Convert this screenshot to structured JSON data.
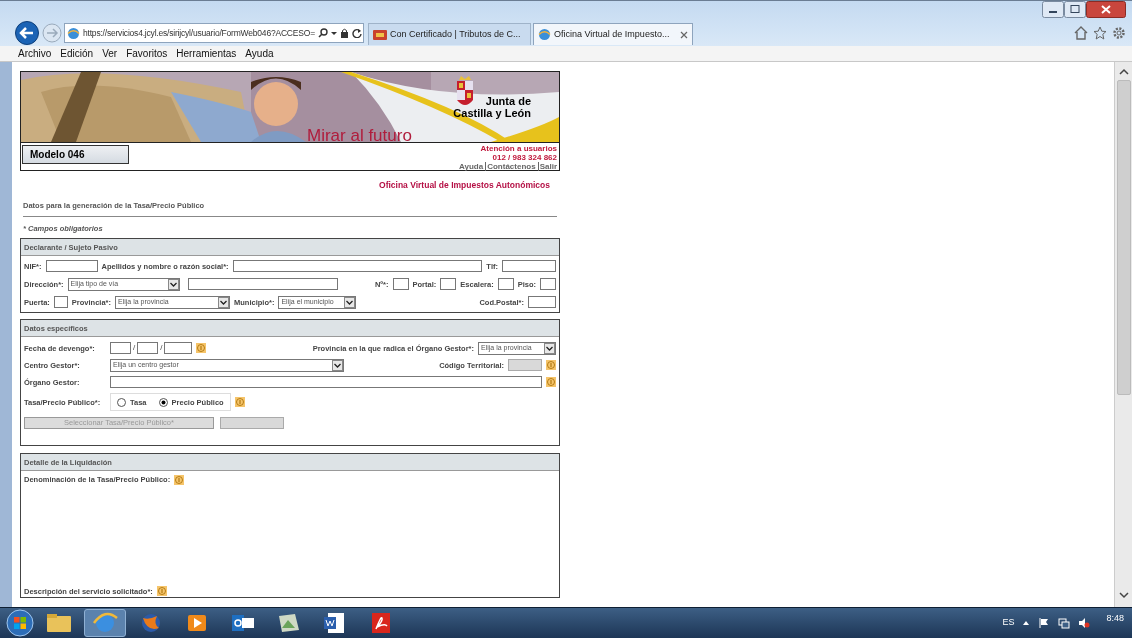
{
  "browser": {
    "address": "https://servicios4.jcyl.es/sirijcyl/usuario/FormWeb046?ACCESO=",
    "tabs": [
      {
        "title": "Con Certificado | Tributos de C...",
        "selected": false
      },
      {
        "title": "Oficina Virtual de Impuesto...",
        "selected": true
      }
    ]
  },
  "menu": [
    "Archivo",
    "Edición",
    "Ver",
    "Favoritos",
    "Herramientas",
    "Ayuda"
  ],
  "header": {
    "slogan": "Mirar al futuro",
    "logo": [
      "Junta de",
      "Castilla y León"
    ],
    "model": "Modelo 046",
    "contact": [
      "Atención a usuarios",
      "012 / 983 324 862"
    ],
    "links": [
      "Ayuda",
      "Contáctenos",
      "Salir"
    ]
  },
  "office": "Oficina Virtual de Impuestos Autonómicos",
  "subtitle": "Datos para la generación de la Tasa/Precio Público",
  "required_note": "* Campos obligatorios",
  "sections": [
    {
      "title": "Declarante / Sujeto Pasivo",
      "lines": [
        {
          "fields": [
            {
              "kind": "label",
              "text": "NIF*:"
            },
            {
              "kind": "input",
              "disabled": false
            },
            {
              "kind": "label",
              "text": "Apellidos y nombre o razón social*:"
            },
            {
              "kind": "input",
              "disabled": false
            },
            {
              "kind": "label",
              "text": "Tlf:"
            },
            {
              "kind": "input",
              "disabled": false
            }
          ]
        },
        {
          "fields": [
            {
              "kind": "label",
              "text": "Dirección*:"
            },
            {
              "kind": "select",
              "value": "Elija tipo de vía"
            },
            {
              "kind": "input",
              "disabled": false
            },
            {
              "kind": "spacer"
            },
            {
              "kind": "label",
              "text": "Nº*:"
            },
            {
              "kind": "input",
              "disabled": false
            },
            {
              "kind": "label",
              "text": "Portal:"
            },
            {
              "kind": "input",
              "disabled": false
            },
            {
              "kind": "label",
              "text": "Escalera:"
            },
            {
              "kind": "input",
              "disabled": false
            },
            {
              "kind": "label",
              "text": "Piso:"
            },
            {
              "kind": "input",
              "disabled": false
            }
          ]
        },
        {
          "fields": [
            {
              "kind": "label",
              "text": "Puerta:"
            },
            {
              "kind": "input",
              "disabled": false
            },
            {
              "kind": "label",
              "text": "Provincia*:"
            },
            {
              "kind": "select",
              "value": "Elija la provincia"
            },
            {
              "kind": "label",
              "text": "Municipio*:"
            },
            {
              "kind": "select",
              "value": "Elija el municipio"
            },
            {
              "kind": "spacer"
            },
            {
              "kind": "label",
              "text": "Cod.Postal*:"
            },
            {
              "kind": "input",
              "disabled": false
            }
          ]
        }
      ]
    },
    {
      "title": "Datos específicos",
      "lines": [
        {
          "fields": [
            {
              "kind": "label",
              "text": "Fecha de devengo*:"
            },
            {
              "kind": "input",
              "disabled": false
            },
            {
              "kind": "sep",
              "text": "/"
            },
            {
              "kind": "input",
              "disabled": false
            },
            {
              "kind": "sep",
              "text": "/"
            },
            {
              "kind": "input",
              "disabled": false
            },
            {
              "kind": "info"
            },
            {
              "kind": "spacer"
            },
            {
              "kind": "label",
              "text": "Provincia en la que radica el Órgano Gestor*:"
            },
            {
              "kind": "select",
              "value": "Elija la provincia"
            }
          ]
        },
        {
          "fields": [
            {
              "kind": "label",
              "text": "Centro Gestor*:"
            },
            {
              "kind": "select",
              "value": "Elija un centro gestor"
            },
            {
              "kind": "spacer"
            },
            {
              "kind": "label",
              "text": "Código Territorial:"
            },
            {
              "kind": "input",
              "disabled": true
            },
            {
              "kind": "info"
            }
          ]
        },
        {
          "fields": [
            {
              "kind": "label",
              "text": "Órgano Gestor:"
            },
            {
              "kind": "input",
              "disabled": false
            },
            {
              "kind": "info"
            }
          ]
        },
        {
          "fields": [
            {
              "kind": "label",
              "text": "Tasa/Precio Público*:"
            },
            {
              "kind": "radios",
              "options": [
                {
                  "label": "Tasa",
                  "selected": false
                },
                {
                  "label": "Precio Público",
                  "selected": true
                }
              ]
            },
            {
              "kind": "info"
            }
          ]
        },
        {
          "fields": [
            {
              "kind": "button",
              "text": "Seleccionar Tasa/Precio Público*",
              "disabled": true
            },
            {
              "kind": "input",
              "disabled": true
            }
          ]
        }
      ]
    },
    {
      "title": "Detalle de la Liquidación",
      "lines": [
        {
          "fields": [
            {
              "kind": "label",
              "text": "Denominación de la Tasa/Precio Público:"
            },
            {
              "kind": "info"
            }
          ]
        },
        {
          "fields": [
            {
              "kind": "label",
              "text": "Descripción del servicio solicitado*:"
            },
            {
              "kind": "info"
            }
          ]
        }
      ]
    }
  ],
  "taskbar": {
    "language": "ES",
    "time": "8:48"
  }
}
